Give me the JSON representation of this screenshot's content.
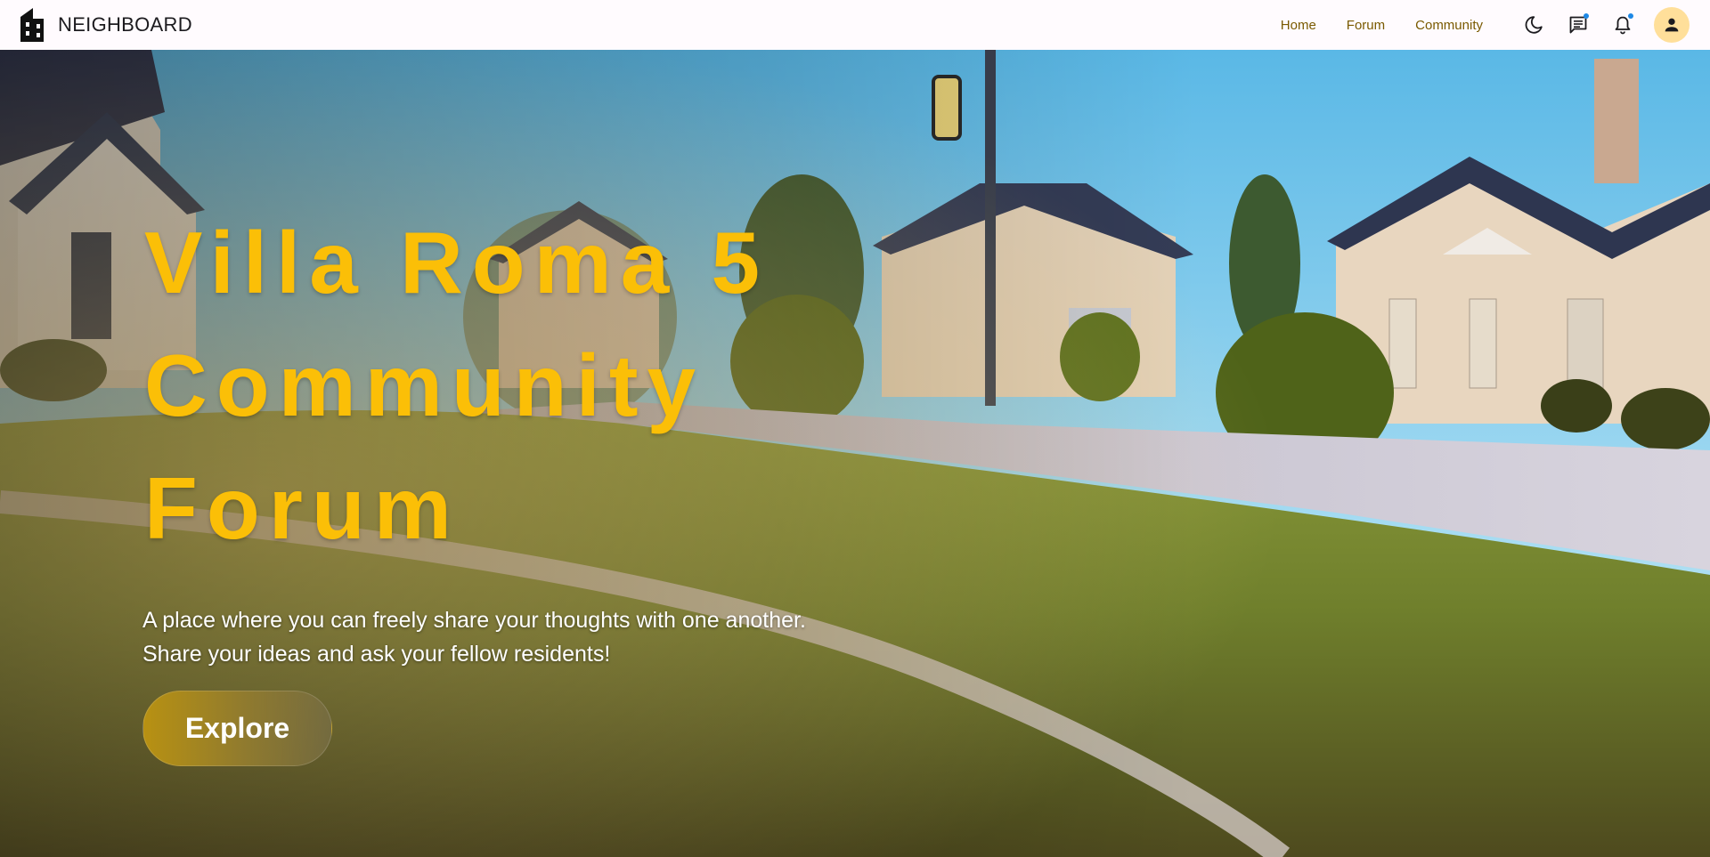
{
  "brand": {
    "name": "NEIGHBOARD",
    "logo_icon": "building-icon"
  },
  "nav": {
    "links": [
      {
        "label": "Home"
      },
      {
        "label": "Forum"
      },
      {
        "label": "Community"
      }
    ],
    "icons": [
      "moon-icon",
      "chat-icon",
      "bell-icon",
      "person-icon"
    ],
    "link_color": "#7a5a00",
    "notification_dot_color": "#1e88e5"
  },
  "hero": {
    "title_lines": [
      "Villa Roma 5",
      "Community",
      "Forum"
    ],
    "subtitle_lines": [
      "A place where you can freely share your thoughts with one another.",
      "Share your ideas and ask your fellow residents!"
    ],
    "cta_label": "Explore",
    "title_color": "#fbbf07"
  }
}
